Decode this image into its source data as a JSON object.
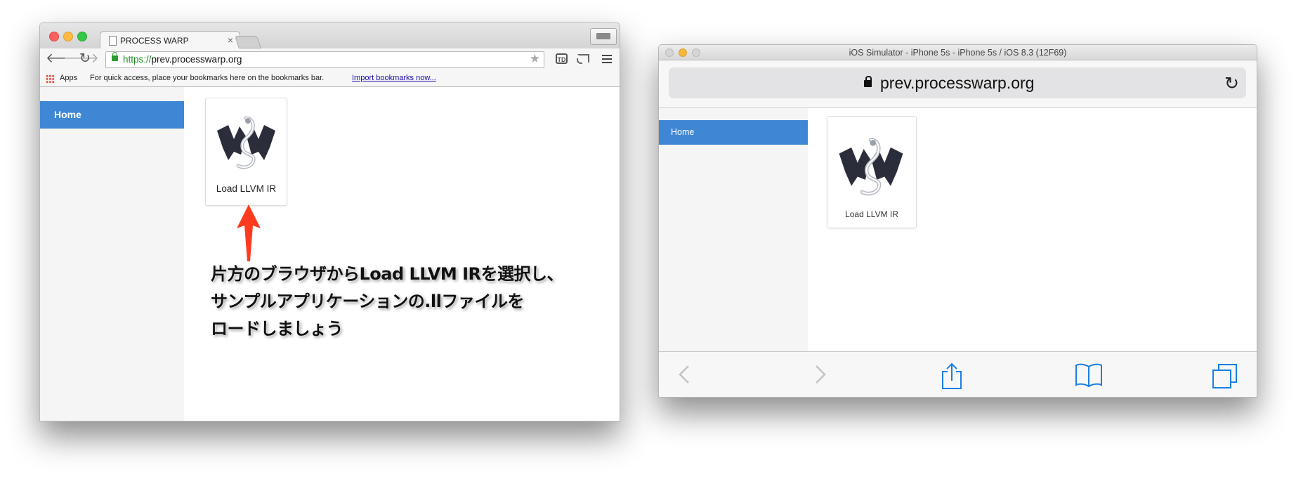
{
  "chrome": {
    "tab_title": "PROCESS WARP",
    "tab_close": "×",
    "url_scheme": "https://",
    "url_host": "prev.processwarp.org",
    "bookmarks": {
      "apps_label": "Apps",
      "hint": "For quick access, place your bookmarks here on the bookmarks bar.",
      "import_link": "Import bookmarks now..."
    },
    "sidebar_home": "Home",
    "card_label": "Load LLVM IR",
    "annotation": {
      "line1": "片方のブラウザからLoad LLVM IRを選択し、",
      "line2": "サンプルアプリケーションの.llファイルを",
      "line3": "ロードしましょう"
    },
    "arrow_color": "#ff3b1f"
  },
  "simulator": {
    "window_title": "iOS Simulator - iPhone 5s - iPhone 5s / iOS 8.3 (12F69)",
    "url": "prev.processwarp.org",
    "sidebar_home": "Home",
    "card_label": "Load LLVM IR",
    "toolbar_icons": [
      "back-icon",
      "forward-icon",
      "share-icon",
      "bookmarks-icon",
      "tabs-icon"
    ]
  },
  "colors": {
    "accent": "#3f87d4",
    "ios_tint": "#1a7fe2"
  }
}
